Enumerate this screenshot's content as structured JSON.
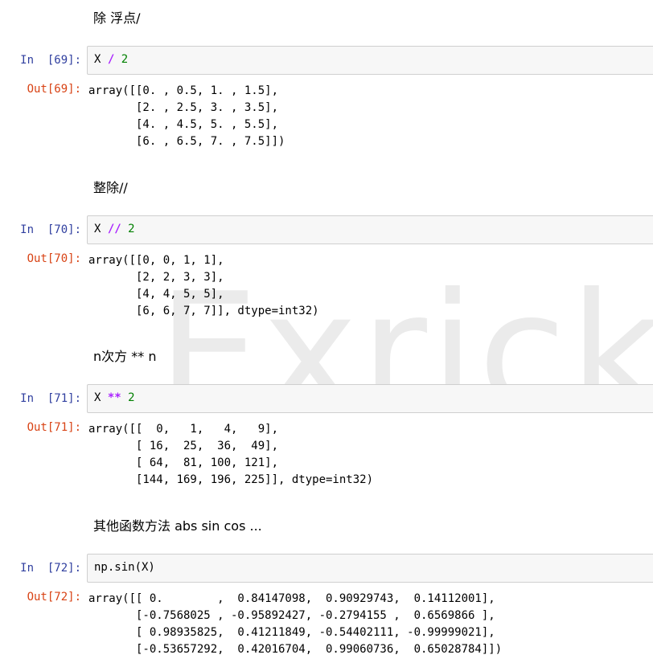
{
  "watermark": "Exrick",
  "cells": [
    {
      "markdown": "除 浮点/",
      "in_prompt": "In  [69]:",
      "code_prefix": "X ",
      "code_op": "/",
      "code_mid": " ",
      "code_num": "2",
      "code_plain": "",
      "out_prompt": "Out[69]:",
      "output": "array([[0. , 0.5, 1. , 1.5],\n       [2. , 2.5, 3. , 3.5],\n       [4. , 4.5, 5. , 5.5],\n       [6. , 6.5, 7. , 7.5]])"
    },
    {
      "markdown": "整除//",
      "in_prompt": "In  [70]:",
      "code_prefix": "X ",
      "code_op": "//",
      "code_mid": " ",
      "code_num": "2",
      "code_plain": "",
      "out_prompt": "Out[70]:",
      "output": "array([[0, 0, 1, 1],\n       [2, 2, 3, 3],\n       [4, 4, 5, 5],\n       [6, 6, 7, 7]], dtype=int32)"
    },
    {
      "markdown": "n次方 ** n",
      "in_prompt": "In  [71]:",
      "code_prefix": "X ",
      "code_op": "**",
      "code_mid": " ",
      "code_num": "2",
      "code_plain": "",
      "out_prompt": "Out[71]:",
      "output": "array([[  0,   1,   4,   9],\n       [ 16,  25,  36,  49],\n       [ 64,  81, 100, 121],\n       [144, 169, 196, 225]], dtype=int32)"
    },
    {
      "markdown": "其他函数方法 abs sin cos ...",
      "in_prompt": "In  [72]:",
      "code_prefix": "",
      "code_op": "",
      "code_mid": "",
      "code_num": "",
      "code_plain": "np.sin(X)",
      "out_prompt": "Out[72]:",
      "output": "array([[ 0.        ,  0.84147098,  0.90929743,  0.14112001],\n       [-0.7568025 , -0.95892427, -0.2794155 ,  0.6569866 ],\n       [ 0.98935825,  0.41211849, -0.54402111, -0.99999021],\n       [-0.53657292,  0.42016704,  0.99060736,  0.65028784]])"
    }
  ]
}
